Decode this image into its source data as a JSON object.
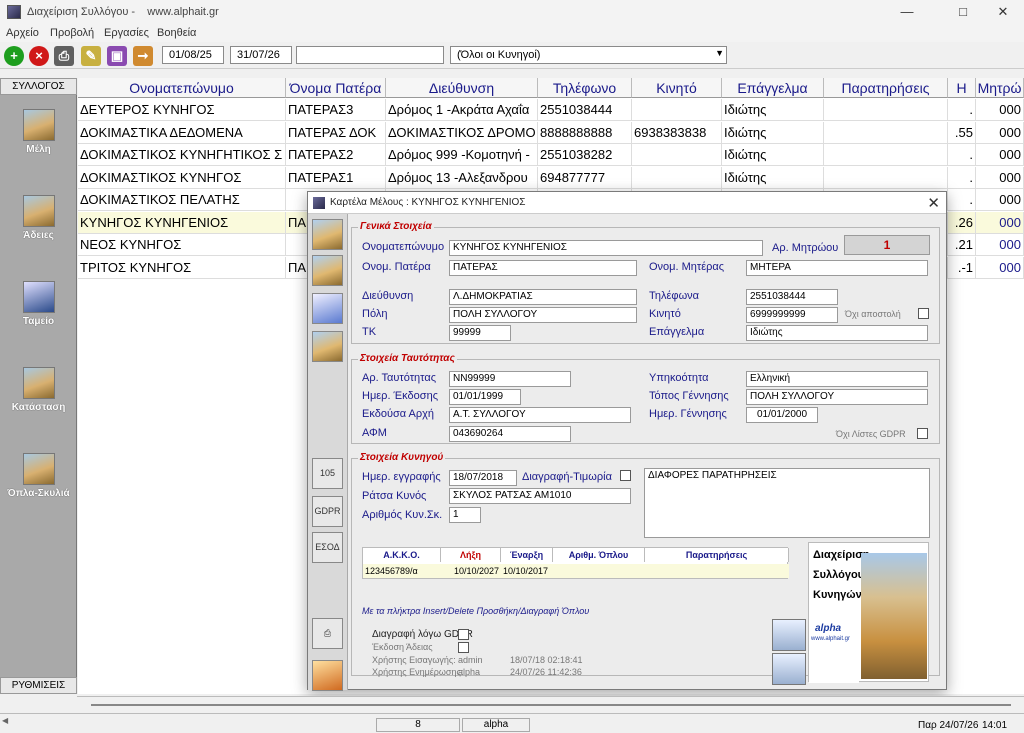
{
  "window": {
    "title": "Διαχείριση Συλλόγου -",
    "site": "www.alphait.gr"
  },
  "menu": [
    "Αρχείο",
    "Προβολή",
    "Εργασίες",
    "Βοηθεία"
  ],
  "toolbar": {
    "date_from": "01/08/25",
    "date_to": "31/07/26",
    "search_value": "",
    "filter_selected": "(Όλοι οι Κυνηγοί)"
  },
  "sidebar": {
    "header": "ΣΥΛΛΟΓΟΣ",
    "items": [
      "Μέλη",
      "Άδειες",
      "Ταμείο",
      "Κατάσταση",
      "Όπλα-Σκυλιά"
    ],
    "footer": "ΡΥΘΜΙΣΕΙΣ"
  },
  "grid": {
    "columns": [
      "Ονοματεπώνυμο",
      "Όνομα Πατέρα",
      "Διεύθυνση",
      "Τηλέφωνο",
      "Κινητό",
      "Επάγγελμα",
      "Παρατηρήσεις",
      "Η",
      "Μητρώ"
    ],
    "rows": [
      [
        "ΔΕΥΤΕΡΟΣ ΚΥΝΗΓΟΣ",
        "ΠΑΤΕΡΑΣ3",
        "Δρόμος 1 -Ακράτα Αχαΐα",
        "2551038444",
        "",
        "Ιδιώτης",
        "",
        ".",
        "000"
      ],
      [
        "ΔΟΚΙΜΑΣΤΙΚΑ ΔΕΔΟΜΕΝΑ",
        "ΠΑΤΕΡΑΣ ΔΟΚ",
        "ΔΟΚΙΜΑΣΤΙΚΟΣ ΔΡΟΜΟ",
        "8888888888",
        "6938383838",
        "Ιδιώτης",
        "",
        ".55",
        "000"
      ],
      [
        "ΔΟΚΙΜΑΣΤΙΚΟΣ ΚΥΝΗΓΗΤΙΚΟΣ Σ",
        "ΠΑΤΕΡΑΣ2",
        "Δρόμος 999 -Κομοτηνή -",
        "2551038282",
        "",
        "Ιδιώτης",
        "",
        ".",
        "000"
      ],
      [
        "ΔΟΚΙΜΑΣΤΙΚΟΣ ΚΥΝΗΓΟΣ",
        "ΠΑΤΕΡΑΣ1",
        "Δρόμος 13 -Αλεξανδρου",
        "694877777",
        "",
        "Ιδιώτης",
        "",
        ".",
        "000"
      ],
      [
        "ΔΟΚΙΜΑΣΤΙΚΟΣ ΠΕΛΑΤΗΣ",
        "",
        "",
        "",
        "",
        "",
        "",
        ".",
        "000"
      ],
      [
        "ΚΥΝΗΓΟΣ ΚΥΝΗΓΕΝΙΟΣ",
        "ΠΑ",
        "",
        "",
        "",
        "",
        "",
        ".26",
        "000"
      ],
      [
        "ΝΕΟΣ ΚΥΝΗΓΟΣ",
        "",
        "",
        "",
        "",
        "",
        "",
        ".21",
        "000"
      ],
      [
        "ΤΡΙΤΟΣ ΚΥΝΗΓΟΣ",
        "ΠΑ",
        "",
        "",
        "",
        "",
        "",
        ".-1",
        "000"
      ]
    ]
  },
  "dialog": {
    "title": "Καρτέλα Μέλους : ΚΥΝΗΓΟΣ ΚΥΝΗΓΕΝΙΟΣ",
    "general": {
      "legend": "Γενικά Στοιχεία",
      "name_label": "Ονοματεπώνυμο",
      "name": "ΚΥΝΗΓΟΣ ΚΥΝΗΓΕΝΙΟΣ",
      "regno_label": "Αρ. Μητρώου",
      "regno": "1",
      "father_label": "Ονομ. Πατέρα",
      "father": "ΠΑΤΕΡΑΣ",
      "mother_label": "Ονομ. Μητέρας",
      "mother": "ΜΗΤΕΡΑ",
      "address_label": "Διεύθυνση",
      "address": "Λ.ΔΗΜΟΚΡΑΤΙΑΣ",
      "phone_label": "Τηλέφωνα",
      "phone": "2551038444",
      "city_label": "Πόλη",
      "city": "ΠΟΛΗ ΣΥΛΛΟΓΟΥ",
      "mobile_label": "Κινητό",
      "mobile": "6999999999",
      "nosend_label": "Όχι αποστολή",
      "zip_label": "ΤΚ",
      "zip": "99999",
      "job_label": "Επάγγελμα",
      "job": "Ιδιώτης"
    },
    "identity": {
      "legend": "Στοιχεία Ταυτότητας",
      "idno_label": "Αρ. Ταυτότητας",
      "idno": "ΝΝ99999",
      "citizenship_label": "Υπηκοότητα",
      "citizenship": "Ελληνική",
      "issue_date_label": "Ημερ. Έκδοσης",
      "issue_date": "01/01/1999",
      "birthplace_label": "Τόπος Γέννησης",
      "birthplace": "ΠΟΛΗ ΣΥΛΛΟΓΟΥ",
      "authority_label": "Εκδούσα Αρχή",
      "authority": "Α.Τ. ΣΥΛΛΟΓΟΥ",
      "birthdate_label": "Ημερ. Γέννησης",
      "birthdate": "01/01/2000",
      "afm_label": "ΑΦΜ",
      "afm": "043690264",
      "gdpr_label": "Όχι Λίστες GDPR"
    },
    "hunting": {
      "legend": "Στοιχεία Κυνηγού",
      "reg_date_label": "Ημερ. εγγραφής",
      "reg_date": "18/07/2018",
      "delete_label": "Διαγραφή-Τιμωρία",
      "notes": "ΔΙΑΦΟΡΕΣ ΠΑΡΑΤΗΡΗΣΕΙΣ",
      "breed_label": "Ράτσα Κυνός",
      "breed": "ΣΚΥΛΟΣ ΡΑΤΣΑΣ ΑΜ1010",
      "dogs_label": "Αριθμός Κυν.Σκ.",
      "dogs": "1"
    },
    "weapons": {
      "columns": [
        "Α.Κ.Κ.Ο.",
        "Λήξη",
        "Έναρξη",
        "Αριθμ. Όπλου",
        "Παρατηρήσεις"
      ],
      "rows": [
        [
          "123456789/α",
          "10/10/2027",
          "10/10/2017",
          "",
          ""
        ]
      ],
      "hint": "Με τα πλήκτρα Insert/Delete Προσθήκη/Διαγραφή Όπλου"
    },
    "logo_text": [
      "Διαχείριση",
      "Συλλόγου",
      "Κυνηγών"
    ],
    "logo_brand": "alpha",
    "logo_url": "www.alphait.gr",
    "footer": {
      "gdpr_delete_label": "Διαγραφή λόγω GDPR",
      "license_label": "Έκδοση Άδειας",
      "insert_user_label": "Χρήστης Εισαγωγής:",
      "insert_user": "admin",
      "insert_time": "18/07/18 02:18:41",
      "update_user_label": "Χρήστης Ενημέρωσης:",
      "update_user": "alpha",
      "update_time": "24/07/26 11:42:36"
    }
  },
  "status": {
    "count": "8",
    "user": "alpha",
    "date": "Παρ  24/07/26",
    "time": "14:01"
  }
}
